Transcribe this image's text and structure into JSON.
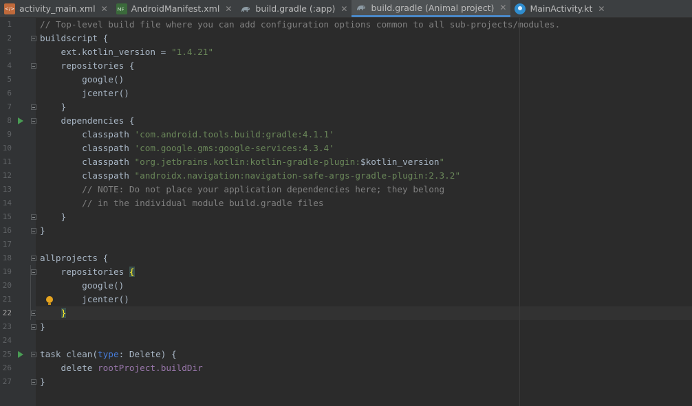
{
  "tabs": [
    {
      "label": "activity_main.xml",
      "icon": "xml-file-icon",
      "active": false
    },
    {
      "label": "AndroidManifest.xml",
      "icon": "manifest-file-icon",
      "active": false
    },
    {
      "label": "build.gradle (:app)",
      "icon": "gradle-icon",
      "active": false
    },
    {
      "label": "build.gradle (Animal project)",
      "icon": "gradle-icon",
      "active": true
    },
    {
      "label": "MainActivity.kt",
      "icon": "kotlin-file-icon",
      "active": false
    }
  ],
  "close_glyph": "✕",
  "editor": {
    "current_line": 22,
    "lines": [
      {
        "n": "1",
        "tokens": [
          [
            "c",
            "// Top-level build file where you can add configuration options common to all sub-projects/modules."
          ]
        ]
      },
      {
        "n": "2",
        "tokens": [
          [
            "p",
            "buildscript {"
          ]
        ]
      },
      {
        "n": "3",
        "tokens": [
          [
            "p",
            "    ext.kotlin_version = "
          ],
          [
            "s",
            "\"1.4.21\""
          ]
        ]
      },
      {
        "n": "4",
        "tokens": [
          [
            "p",
            "    repositories {"
          ]
        ]
      },
      {
        "n": "5",
        "tokens": [
          [
            "p",
            "        google()"
          ]
        ]
      },
      {
        "n": "6",
        "tokens": [
          [
            "p",
            "        jcenter()"
          ]
        ]
      },
      {
        "n": "7",
        "tokens": [
          [
            "p",
            "    }"
          ]
        ]
      },
      {
        "n": "8",
        "tokens": [
          [
            "p",
            "    dependencies {"
          ]
        ]
      },
      {
        "n": "9",
        "tokens": [
          [
            "p",
            "        classpath "
          ],
          [
            "s",
            "'com.android.tools.build:gradle:4.1.1'"
          ]
        ]
      },
      {
        "n": "10",
        "tokens": [
          [
            "p",
            "        classpath "
          ],
          [
            "s",
            "'com.google.gms:google-services:4.3.4'"
          ]
        ]
      },
      {
        "n": "11",
        "tokens": [
          [
            "p",
            "        classpath "
          ],
          [
            "s",
            "\"org.jetbrains.kotlin:kotlin-gradle-plugin:"
          ],
          [
            "p",
            "$kotlin_version"
          ],
          [
            "s",
            "\""
          ]
        ]
      },
      {
        "n": "12",
        "tokens": [
          [
            "p",
            "        classpath "
          ],
          [
            "s",
            "\"androidx.navigation:navigation-safe-args-gradle-plugin:2.3.2\""
          ]
        ]
      },
      {
        "n": "13",
        "tokens": [
          [
            "c",
            "        // NOTE: Do not place your application dependencies here; they belong"
          ]
        ]
      },
      {
        "n": "14",
        "tokens": [
          [
            "c",
            "        // in the individual module build.gradle files"
          ]
        ]
      },
      {
        "n": "15",
        "tokens": [
          [
            "p",
            "    }"
          ]
        ]
      },
      {
        "n": "16",
        "tokens": [
          [
            "p",
            "}"
          ]
        ]
      },
      {
        "n": "17",
        "tokens": []
      },
      {
        "n": "18",
        "tokens": [
          [
            "p",
            "allprojects {"
          ]
        ]
      },
      {
        "n": "19",
        "tokens": [
          [
            "p",
            "    repositories "
          ],
          [
            "b",
            "{"
          ]
        ]
      },
      {
        "n": "20",
        "tokens": [
          [
            "p",
            "        google()"
          ]
        ]
      },
      {
        "n": "21",
        "tokens": [
          [
            "p",
            "        jcenter()"
          ]
        ]
      },
      {
        "n": "22",
        "tokens": [
          [
            "p",
            "    "
          ],
          [
            "b",
            "}"
          ]
        ]
      },
      {
        "n": "23",
        "tokens": [
          [
            "p",
            "}"
          ]
        ]
      },
      {
        "n": "24",
        "tokens": []
      },
      {
        "n": "25",
        "tokens": [
          [
            "p",
            "task clean("
          ],
          [
            "m",
            "type"
          ],
          [
            "p",
            ": Delete) {"
          ]
        ]
      },
      {
        "n": "26",
        "tokens": [
          [
            "p",
            "    delete "
          ],
          [
            "v",
            "rootProject.buildDir"
          ]
        ]
      },
      {
        "n": "27",
        "tokens": [
          [
            "p",
            "}"
          ]
        ]
      }
    ],
    "run_markers": [
      "8",
      "25"
    ],
    "fold_markers": [
      "2",
      "4",
      "7",
      "8",
      "15",
      "16",
      "18",
      "19",
      "22",
      "23",
      "25",
      "27"
    ],
    "intention_bulb_line": "21"
  },
  "colors": {
    "background": "#2b2b2b",
    "gutter": "#313335",
    "comment": "#808080",
    "string": "#6a8759",
    "text": "#a9b7c6",
    "run_marker": "#499c54",
    "active_tab_underline": "#4a88c7"
  }
}
